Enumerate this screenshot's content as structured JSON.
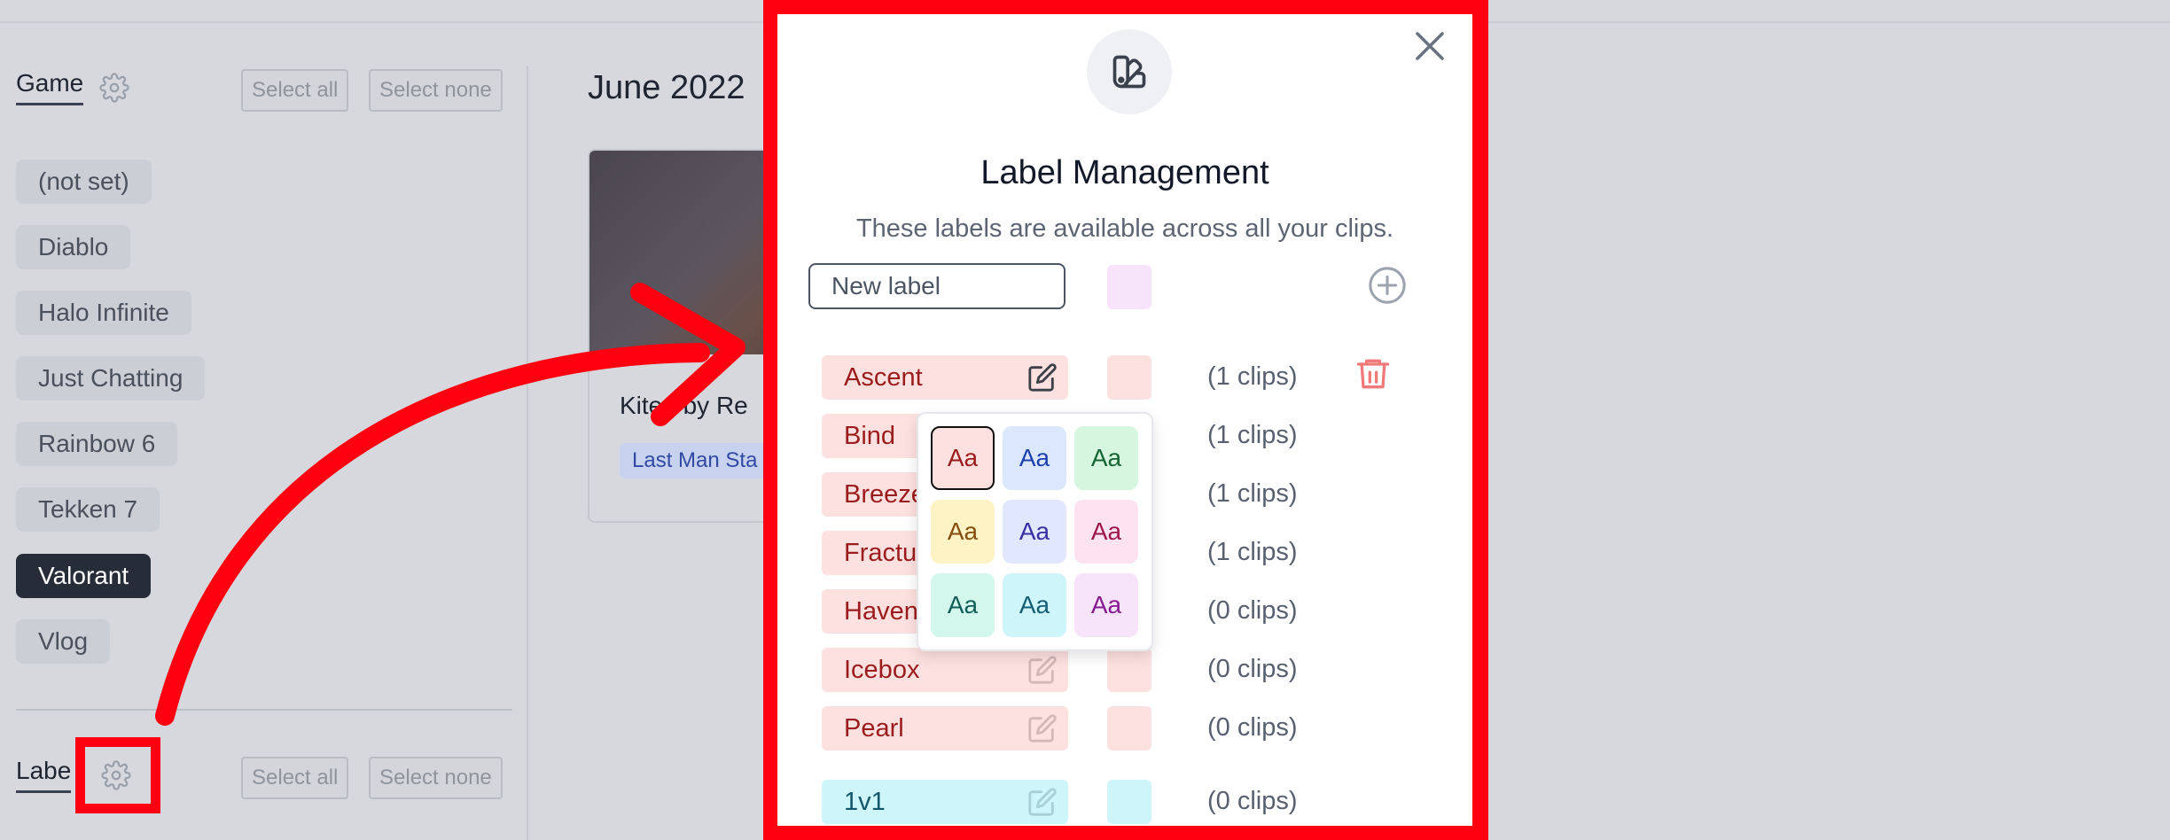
{
  "sidebar": {
    "game_section": {
      "title": "Game",
      "select_all": "Select all",
      "select_none": "Select none",
      "items": [
        "(not set)",
        "Diablo",
        "Halo Infinite",
        "Just Chatting",
        "Rainbow 6",
        "Tekken 7",
        "Valorant",
        "Vlog"
      ],
      "active_item": "Valorant"
    },
    "label_section": {
      "title": "Labe",
      "select_all": "Select all",
      "select_none": "Select none"
    }
  },
  "content": {
    "month": "June 2022",
    "card": {
      "title": "Kited by Re",
      "tag": "Last Man Sta"
    }
  },
  "modal": {
    "title": "Label Management",
    "subtitle": "These labels are available across all your clips.",
    "new_label_placeholder": "New label",
    "labels": [
      {
        "name": "Ascent",
        "clips": "(1 clips)"
      },
      {
        "name": "Bind",
        "clips": "(1 clips)"
      },
      {
        "name": "Breeze",
        "clips": "(1 clips)"
      },
      {
        "name": "Fracture",
        "clips": "(1 clips)"
      },
      {
        "name": "Haven",
        "clips": "(0 clips)"
      },
      {
        "name": "Icebox",
        "clips": "(0 clips)"
      },
      {
        "name": "Pearl",
        "clips": "(0 clips)"
      },
      {
        "name": "1v1",
        "clips": "(0 clips)"
      }
    ],
    "color_options": [
      "Aa",
      "Aa",
      "Aa",
      "Aa",
      "Aa",
      "Aa",
      "Aa",
      "Aa",
      "Aa"
    ]
  },
  "colors": {
    "annotation_red": "#ff0010",
    "label_red_bg": "#fde0e0",
    "label_red_text": "#9b1c1c",
    "label_cyan_bg": "#cdf5fa",
    "new_label_swatch": "#f7e4fb",
    "active_chip": "#272d38"
  },
  "icons": {
    "modal_icon": "swatch-book-icon",
    "close": "close-icon",
    "add": "plus-circle-icon",
    "edit": "edit-icon",
    "delete": "trash-icon",
    "settings": "gear-icon"
  }
}
